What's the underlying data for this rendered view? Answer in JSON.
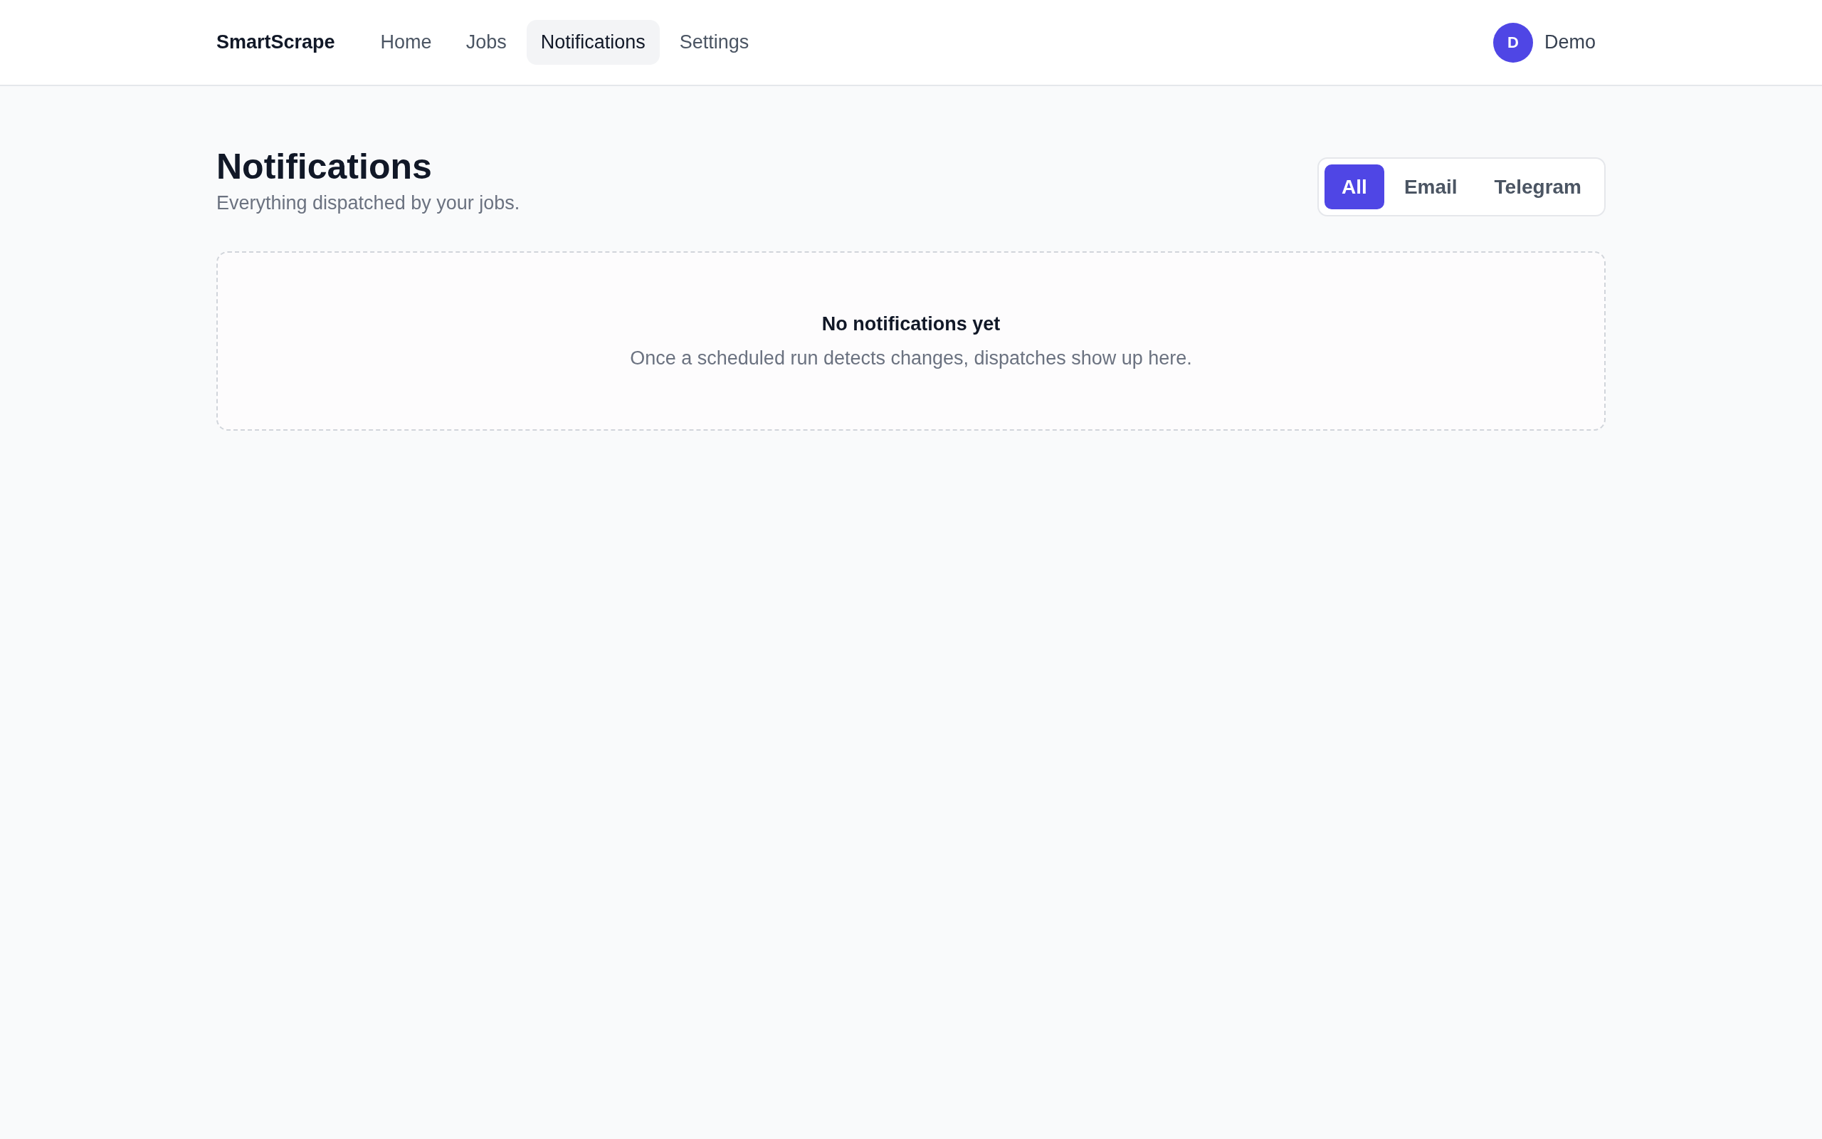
{
  "nav": {
    "brand": "SmartScrape",
    "items": [
      {
        "label": "Home",
        "selected": false
      },
      {
        "label": "Jobs",
        "selected": false
      },
      {
        "label": "Notifications",
        "selected": true
      },
      {
        "label": "Settings",
        "selected": false
      }
    ],
    "user": {
      "initial": "D",
      "name": "Demo"
    }
  },
  "header": {
    "title": "Notifications",
    "subtitle": "Everything dispatched by your jobs."
  },
  "filter": [
    {
      "label": "All",
      "selected": true
    },
    {
      "label": "Email",
      "selected": false
    },
    {
      "label": "Telegram",
      "selected": false
    }
  ],
  "empty_state": {
    "title": "No notifications yet",
    "message": "Once a scheduled run detects changes, dispatches show up here."
  }
}
